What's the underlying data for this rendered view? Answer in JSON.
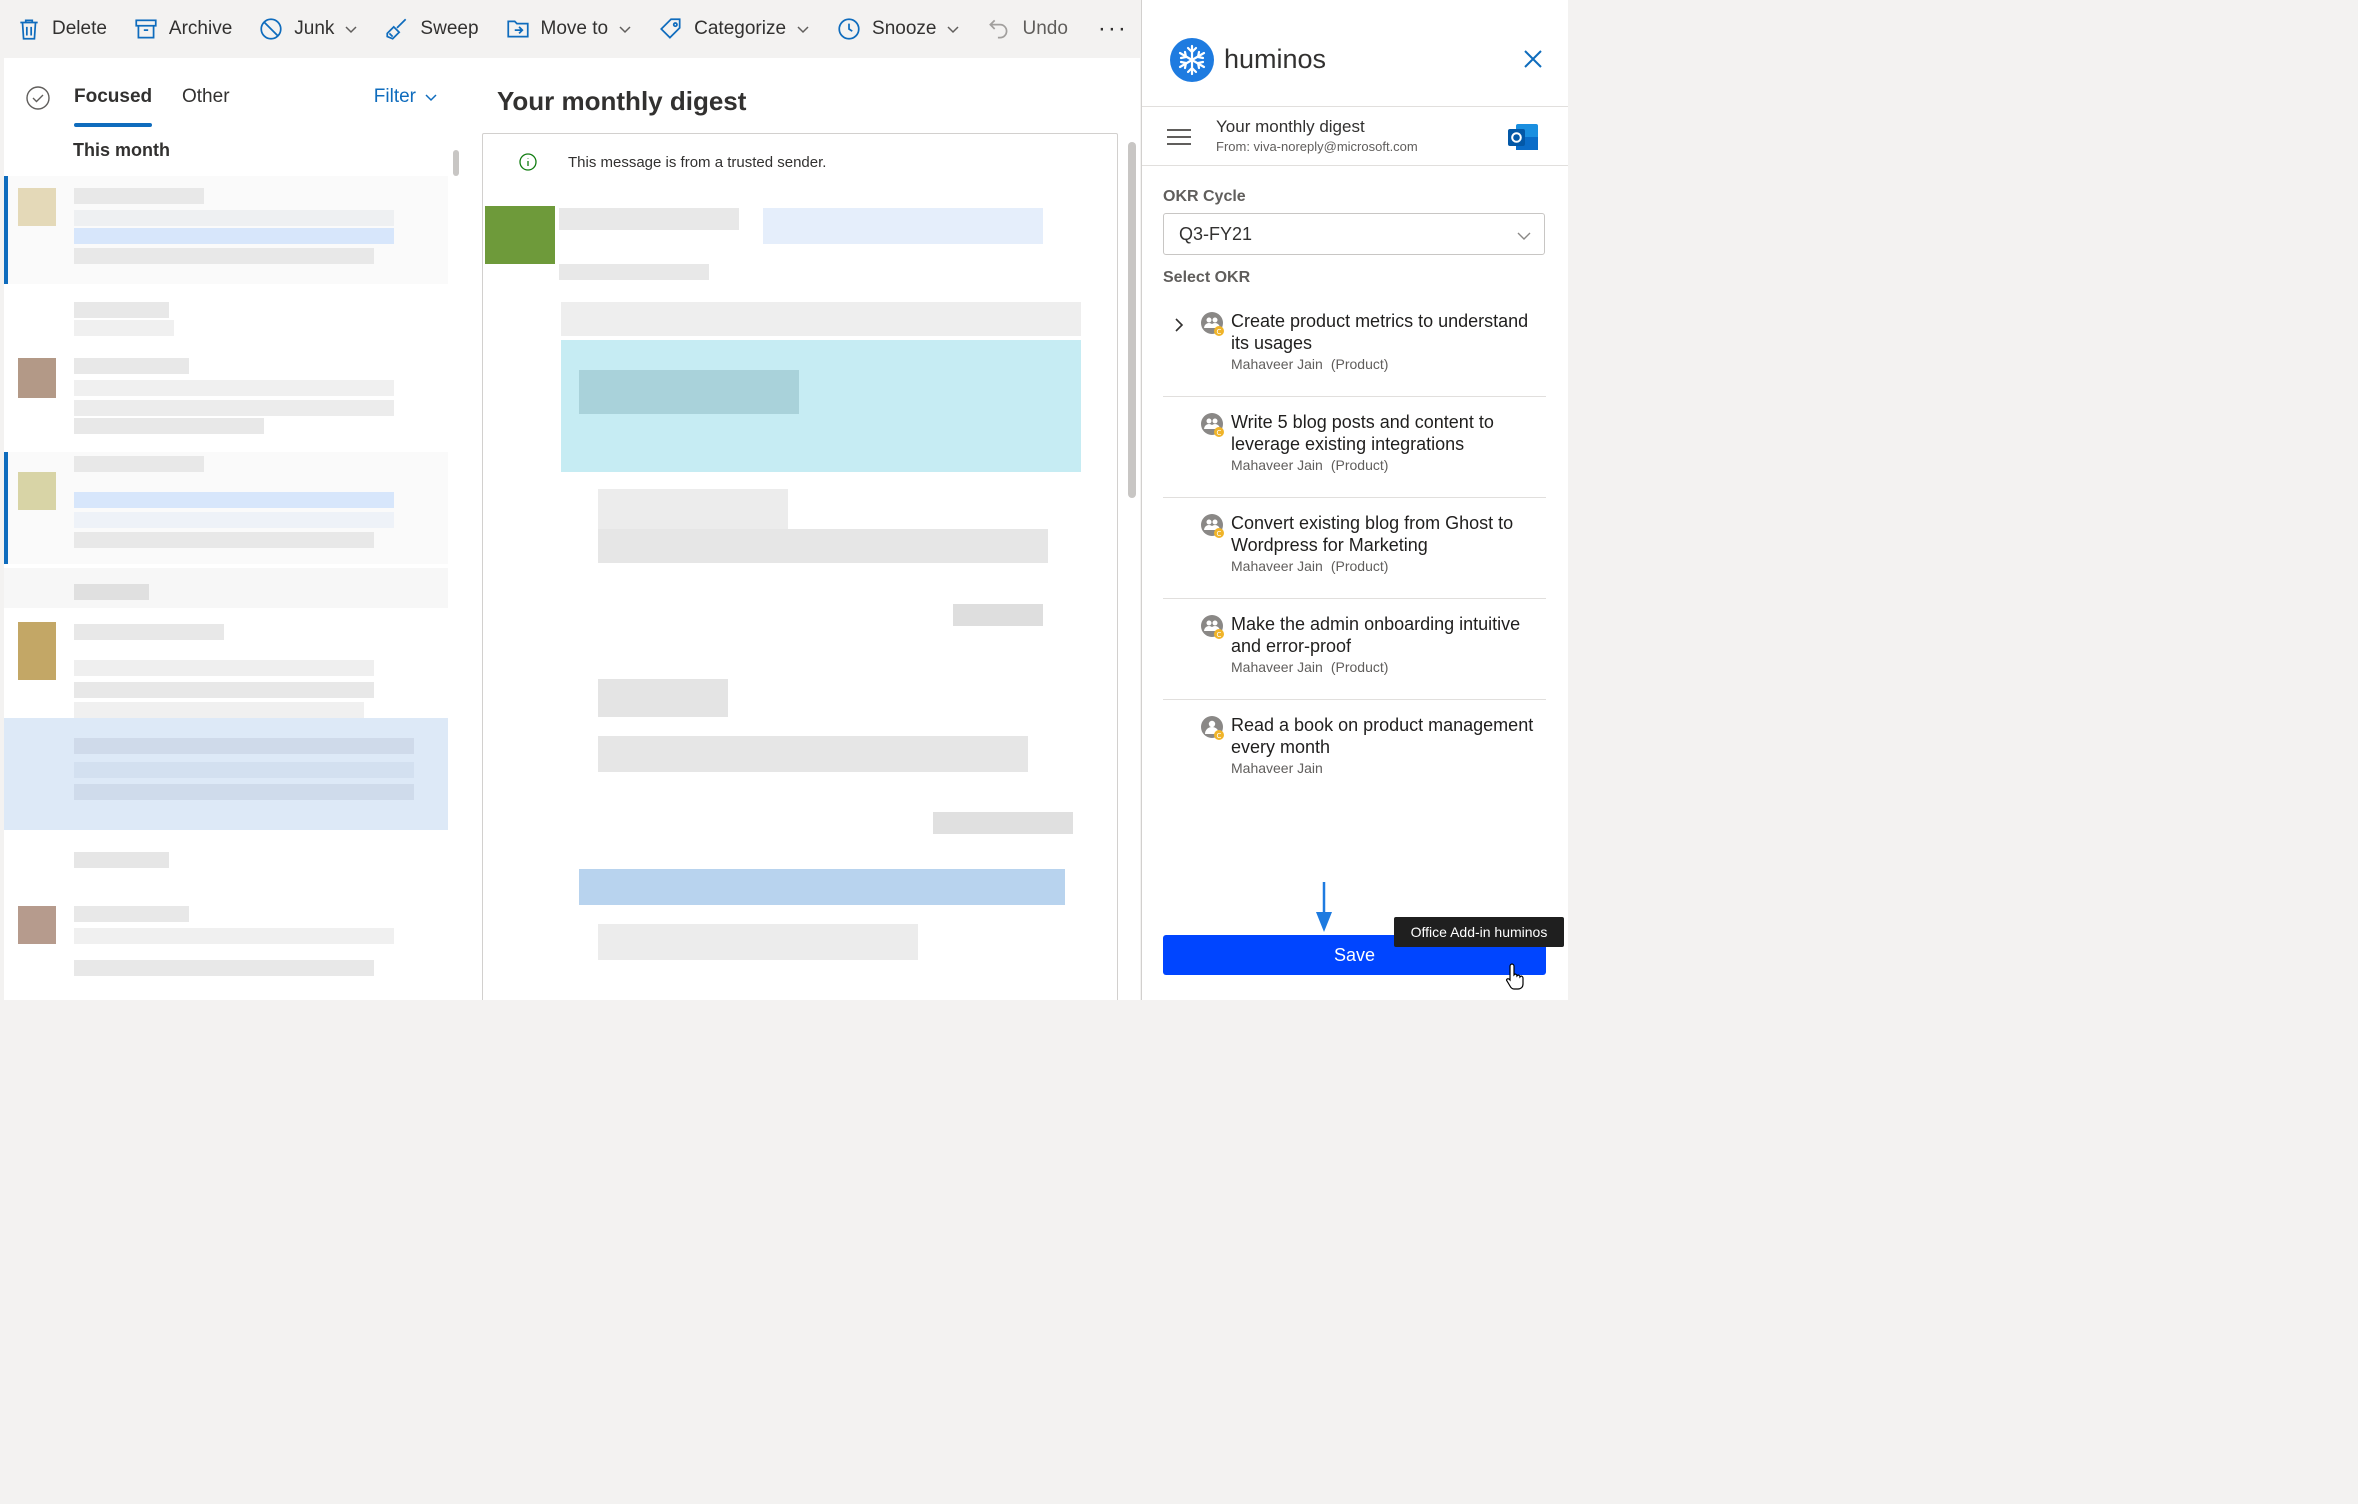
{
  "toolbar": {
    "delete": "Delete",
    "archive": "Archive",
    "junk": "Junk",
    "sweep": "Sweep",
    "move_to": "Move to",
    "categorize": "Categorize",
    "snooze": "Snooze",
    "undo": "Undo",
    "more": "···"
  },
  "mail_list": {
    "tabs": {
      "focused": "Focused",
      "other": "Other"
    },
    "filter": "Filter",
    "group_header": "This month"
  },
  "reading_pane": {
    "subject": "Your monthly digest",
    "trusted_notice": "This message is from a trusted sender."
  },
  "addin": {
    "brand": "huminos",
    "mail_subject": "Your monthly digest",
    "mail_from": "From: viva-noreply@microsoft.com",
    "okr_cycle_label": "OKR Cycle",
    "okr_cycle_value": "Q3-FY21",
    "select_okr_label": "Select OKR",
    "okrs": [
      {
        "title": "Create product metrics to understand its usages",
        "owner": "Mahaveer Jain",
        "dept": "(Product)"
      },
      {
        "title": "Write 5 blog posts and content to leverage existing integrations",
        "owner": "Mahaveer Jain",
        "dept": "(Product)"
      },
      {
        "title": "Convert existing blog from Ghost to Wordpress for Marketing",
        "owner": "Mahaveer Jain",
        "dept": "(Product)"
      },
      {
        "title": "Make the admin onboarding intuitive and error-proof",
        "owner": "Mahaveer Jain",
        "dept": "(Product)"
      },
      {
        "title": "Read a book on product management every month",
        "owner": "Mahaveer Jain",
        "dept": ""
      }
    ],
    "save": "Save",
    "tooltip": "Office Add-in huminos"
  },
  "colors": {
    "accent": "#0f6cbd",
    "save_button": "#0045ff",
    "badge": "#f0b429"
  }
}
